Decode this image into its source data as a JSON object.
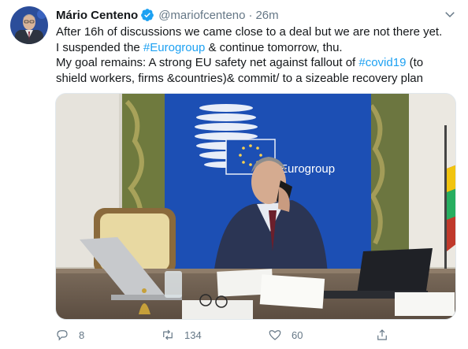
{
  "tweet": {
    "author": {
      "name": "Mário Centeno",
      "handle": "@mariofcenteno",
      "verified": true
    },
    "separator": "·",
    "time": "26m",
    "text_lines": [
      "After 16h of discussions we came close to a deal but we are not there yet.",
      "I suspended the #Eurogroup & continue tomorrow, thu.",
      "My goal remains: A strong EU safety net against fallout of #covid19 (to",
      "shield workers, firms &countries)& commit/ to a sizeable recovery plan"
    ],
    "text_parts": {
      "l2_a": "I suspended the ",
      "l2_tag": "#Eurogroup",
      "l2_b": " & continue tomorrow, thu.",
      "l3_a": "My goal remains: A strong EU safety net against fallout of ",
      "l3_tag": "#covid19",
      "l3_b": " (to"
    },
    "media": {
      "backdrop_text": "Eurogroup"
    },
    "actions": {
      "reply_count": "8",
      "retweet_count": "134",
      "like_count": "60"
    }
  },
  "colors": {
    "link": "#1da1f2",
    "muted": "#657786",
    "verified": "#1da1f2",
    "eu_blue": "#1c4fb4"
  },
  "icons": [
    "verified-badge-icon",
    "caret-down-icon",
    "reply-icon",
    "retweet-icon",
    "like-icon",
    "share-icon"
  ]
}
